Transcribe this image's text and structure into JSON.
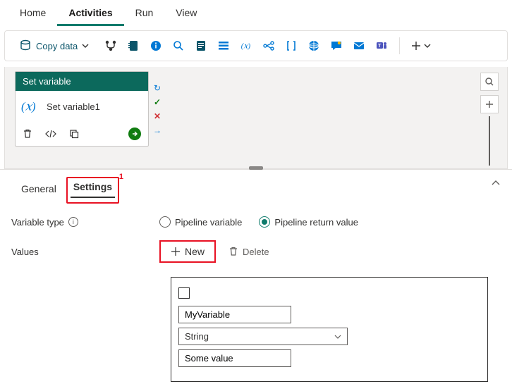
{
  "tabs": {
    "home": "Home",
    "activities": "Activities",
    "run": "Run",
    "view": "View"
  },
  "toolbar": {
    "copy_data": "Copy data"
  },
  "activity": {
    "title": "Set variable",
    "name": "Set variable1"
  },
  "panel_tabs": {
    "general": "General",
    "settings": "Settings"
  },
  "markers": {
    "settings": "1"
  },
  "form": {
    "variable_type_label": "Variable type",
    "values_label": "Values",
    "radio_pipeline_variable": "Pipeline variable",
    "radio_pipeline_return": "Pipeline return value",
    "new_btn": "New",
    "delete_btn": "Delete"
  },
  "value_row": {
    "name": "MyVariable",
    "type": "String",
    "value": "Some value"
  }
}
